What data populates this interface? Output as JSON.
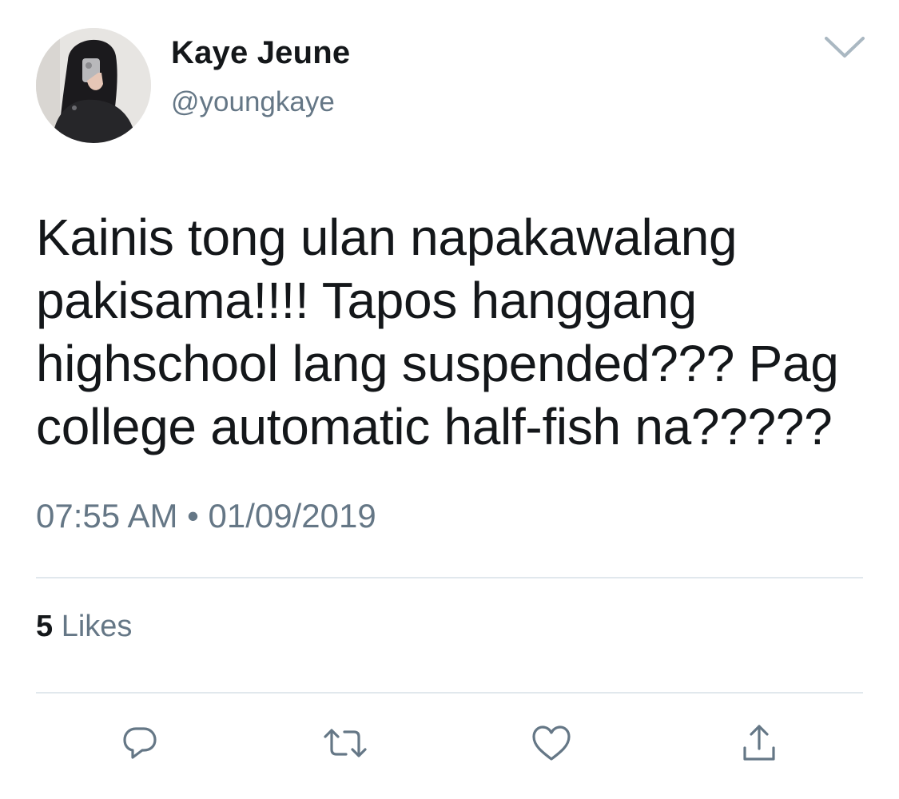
{
  "user": {
    "display_name": "Kaye Jeune",
    "handle": "@youngkaye"
  },
  "tweet": {
    "lines": [
      "Kainis tong ulan napakawalang",
      "pakisama!!!! Tapos hanggang",
      "highschool lang suspended??? Pag",
      "college automatic half-fish na?????"
    ],
    "timestamp": "07:55 AM • 01/09/2019"
  },
  "stats": {
    "likes_count": "5",
    "likes_label": "Likes"
  },
  "icons": {
    "menu": "chevron-down-icon",
    "reply": "reply-icon",
    "retweet": "retweet-icon",
    "like": "heart-icon",
    "share": "share-icon"
  },
  "colors": {
    "text_primary": "#14171a",
    "text_secondary": "#657786",
    "icon": "#657786",
    "divider": "#e1e8ed",
    "background": "#ffffff"
  }
}
